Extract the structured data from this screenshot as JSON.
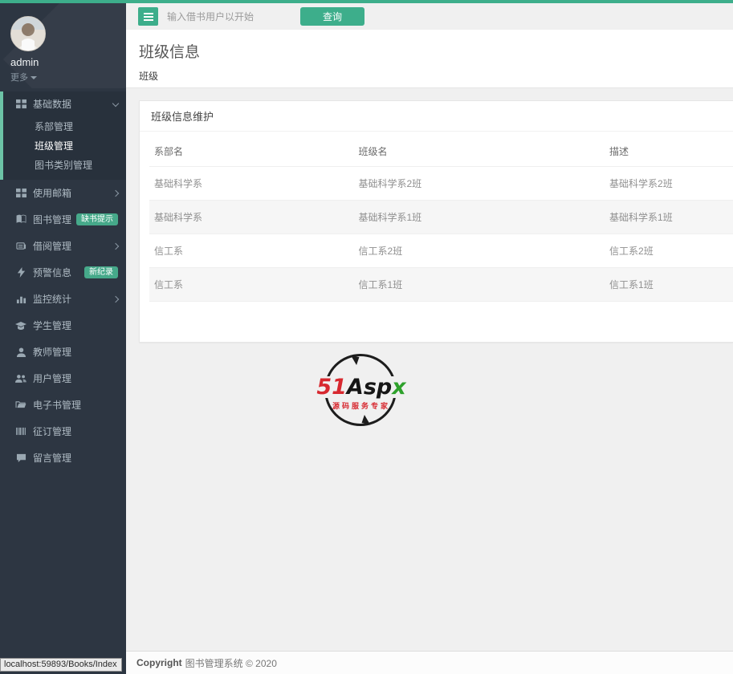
{
  "colors": {
    "accent": "#3dae8b",
    "accent-light": "#6cc3a6",
    "sidebar": "#2d3642"
  },
  "topbar": {
    "search_placeholder": "输入借书用户以开始",
    "query_button": "查询"
  },
  "page": {
    "title": "班级信息",
    "breadcrumb": "班级"
  },
  "sidebar": {
    "user": {
      "name": "admin",
      "more_label": "更多"
    },
    "menu": [
      {
        "label": "基础数据",
        "icon": "grid-icon",
        "state": "expanded",
        "children": [
          "系部管理",
          "班级管理",
          "图书类别管理"
        ],
        "active_child": "班级管理"
      },
      {
        "label": "使用邮箱",
        "icon": "grid-icon"
      },
      {
        "label": "图书管理",
        "icon": "book-icon",
        "badge": "缺书提示"
      },
      {
        "label": "借阅管理",
        "icon": "newspaper-icon"
      },
      {
        "label": "预警信息",
        "icon": "bolt-icon",
        "badge": "新纪录"
      },
      {
        "label": "监控统计",
        "icon": "bar-chart-icon"
      },
      {
        "label": "学生管理",
        "icon": "graduation-icon"
      },
      {
        "label": "教师管理",
        "icon": "user-icon"
      },
      {
        "label": "用户管理",
        "icon": "users-icon"
      },
      {
        "label": "电子书管理",
        "icon": "folder-open-icon"
      },
      {
        "label": "征订管理",
        "icon": "barcode-icon"
      },
      {
        "label": "留言管理",
        "icon": "comment-icon"
      }
    ]
  },
  "panel": {
    "title": "班级信息维护"
  },
  "table": {
    "headers": [
      "系部名",
      "班级名",
      "描述"
    ],
    "rows": [
      [
        "基础科学系",
        "基础科学系2班",
        "基础科学系2班"
      ],
      [
        "基础科学系",
        "基础科学系1班",
        "基础科学系1班"
      ],
      [
        "信工系",
        "信工系2班",
        "信工系2班"
      ],
      [
        "信工系",
        "信工系1班",
        "信工系1班"
      ]
    ]
  },
  "logo": {
    "part1": "51",
    "part2": "Asp",
    "part3": "x",
    "subtitle": "源码服务专家"
  },
  "footer": {
    "bold": "Copyright",
    "rest": "图书管理系统 © 2020"
  },
  "statusbar": {
    "url": "localhost:59893/Books/Index"
  }
}
